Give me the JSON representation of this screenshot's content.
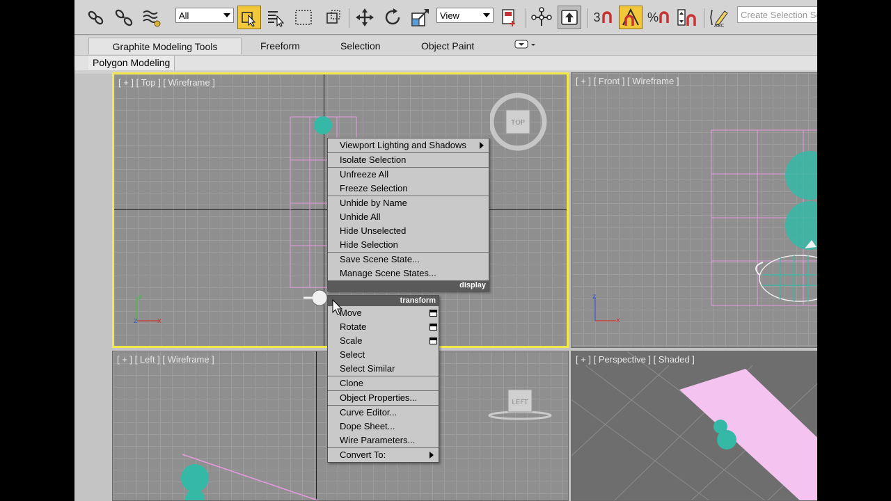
{
  "toolbar": {
    "filter_value": "All",
    "view_value": "View",
    "numeric_labels": [
      "3",
      "%"
    ],
    "selection_set_placeholder": "Create Selection Se"
  },
  "ribbon": {
    "tabs": [
      {
        "label": "Graphite Modeling Tools",
        "active": true
      },
      {
        "label": "Freeform",
        "active": false
      },
      {
        "label": "Selection",
        "active": false
      },
      {
        "label": "Object Paint",
        "active": false
      }
    ],
    "subtab": "Polygon Modeling"
  },
  "viewports": {
    "top": {
      "label": "[ + ] [ Top ] [ Wireframe ]",
      "cube": "TOP"
    },
    "front": {
      "label": "[ + ] [ Front ] [ Wireframe ]"
    },
    "left": {
      "label": "[ + ] [ Left ] [ Wireframe ]",
      "cube": "LEFT"
    },
    "perspective": {
      "label": "[ + ] [ Perspective ] [ Shaded ]"
    }
  },
  "quad_menu": {
    "display": {
      "header": "display",
      "items": [
        {
          "label": "Viewport Lighting and Shadows",
          "submenu": true
        },
        {
          "label": "Isolate Selection"
        },
        {
          "label": "Unfreeze All"
        },
        {
          "label": "Freeze Selection"
        },
        {
          "label": "Unhide by Name"
        },
        {
          "label": "Unhide All"
        },
        {
          "label": "Hide Unselected"
        },
        {
          "label": "Hide Selection"
        },
        {
          "label": "Save Scene State..."
        },
        {
          "label": "Manage Scene States..."
        }
      ]
    },
    "transform": {
      "header": "transform",
      "items": [
        {
          "label": "Move",
          "options": true
        },
        {
          "label": "Rotate",
          "options": true
        },
        {
          "label": "Scale",
          "options": true
        },
        {
          "label": "Select"
        },
        {
          "label": "Select Similar"
        },
        {
          "label": "Clone"
        },
        {
          "label": "Object Properties..."
        },
        {
          "label": "Curve Editor..."
        },
        {
          "label": "Dope Sheet..."
        },
        {
          "label": "Wire Parameters..."
        },
        {
          "label": "Convert To:",
          "submenu": true
        }
      ]
    }
  },
  "colors": {
    "active_viewport_border": "#f3e84a",
    "selection_pink": "#e79be0",
    "object_teal": "#35b9a6",
    "active_tool": "#f2c83a"
  },
  "icons": [
    "select-and-link-icon",
    "unlink-icon",
    "bind-spacewarp-icon",
    "select-object-icon",
    "select-by-name-icon",
    "rect-selection-icon",
    "window-crossing-icon",
    "move-icon",
    "rotate-icon",
    "scale-icon",
    "pivot-icon",
    "manipulate-icon",
    "keyboard-shortcut-icon",
    "snaps-toggle-icon",
    "angle-snap-icon",
    "percent-snap-icon",
    "spinner-snap-icon",
    "edit-named-selection-icon"
  ]
}
